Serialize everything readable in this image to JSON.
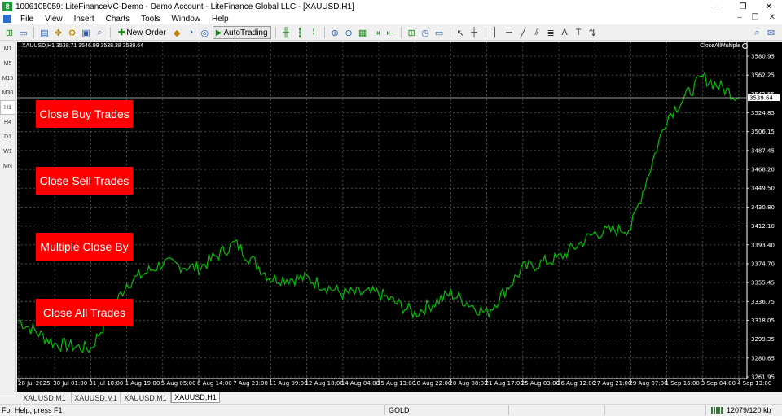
{
  "window": {
    "title": "1006105059: LiteFinanceVC-Demo - Demo Account - LiteFinance Global LLC - [XAUUSD,H1]",
    "app_icon_glyph": "8",
    "controls": [
      "–",
      "❐",
      "✕"
    ]
  },
  "menu": {
    "items": [
      "File",
      "View",
      "Insert",
      "Charts",
      "Tools",
      "Window",
      "Help"
    ],
    "mdi_controls": [
      "–",
      "❐",
      "✕"
    ]
  },
  "toolbar": {
    "new_order_label": "New Order",
    "autotrading_label": "AutoTrading",
    "icons": [
      "new-chart-icon",
      "profiles-icon",
      "market-watch-icon",
      "navigator-icon",
      "data-window-icon",
      "terminal-icon",
      "strategy-tester-icon",
      "new-order-icon",
      "metaeditor-icon",
      "signals-icon",
      "autotrading-icon",
      "bar-chart-icon",
      "candlestick-icon",
      "line-chart-icon",
      "zoom-in-icon",
      "zoom-out-icon",
      "tile-windows-icon",
      "chart-shift-icon",
      "autoscroll-icon",
      "indicators-icon",
      "periods-icon",
      "templates-icon",
      "cursor-icon",
      "crosshair-icon",
      "vertical-line-icon",
      "horizontal-line-icon",
      "trendline-icon",
      "channel-icon",
      "fibonacci-icon",
      "text-icon",
      "text-label-icon",
      "arrows-icon",
      "search-icon",
      "chat-icon"
    ]
  },
  "timeframes": [
    "M1",
    "M5",
    "M15",
    "M30",
    "H1",
    "H4",
    "D1",
    "W1",
    "MN"
  ],
  "active_timeframe": "H1",
  "chart": {
    "header": "XAUUSD,H1  3538.71 3546.99 3538.38 3539.64",
    "ea_name": "CloseAllMultiple",
    "current_price": "3539.64",
    "line_color": "#00c000",
    "grid_color": "#5a5a5a",
    "buttons": [
      {
        "label": "Close Buy Trades"
      },
      {
        "label": "Close Sell Trades"
      },
      {
        "label": "Multiple Close By"
      },
      {
        "label": "Close All Trades"
      }
    ],
    "button_color": "#ff0000",
    "price_labels": [
      "3580.95",
      "3562.25",
      "3543.55",
      "3524.85",
      "3506.15",
      "3487.45",
      "3468.20",
      "3449.50",
      "3430.80",
      "3412.10",
      "3393.40",
      "3374.70",
      "3355.45",
      "3336.75",
      "3318.05",
      "3299.35",
      "3280.65",
      "3261.95"
    ],
    "time_labels": [
      "28 Jul 2025",
      "30 Jul 01:00",
      "31 Jul 10:00",
      "1 Aug 19:00",
      "5 Aug 05:00",
      "6 Aug 14:00",
      "7 Aug 23:00",
      "11 Aug 09:00",
      "12 Aug 18:00",
      "14 Aug 04:00",
      "15 Aug 13:00",
      "18 Aug 22:00",
      "20 Aug 08:00",
      "21 Aug 17:00",
      "25 Aug 03:00",
      "26 Aug 12:00",
      "27 Aug 21:00",
      "29 Aug 07:00",
      "1 Sep 16:00",
      "3 Sep 04:00",
      "4 Sep 13:00"
    ]
  },
  "chart_data": {
    "type": "line",
    "title": "XAUUSD,H1",
    "xlabel": "",
    "ylabel": "",
    "ylim": [
      3261.95,
      3590.0
    ],
    "x": [
      "28 Jul 2025",
      "30 Jul 01:00",
      "31 Jul 10:00",
      "1 Aug 19:00",
      "5 Aug 05:00",
      "6 Aug 14:00",
      "7 Aug 23:00",
      "11 Aug 09:00",
      "12 Aug 18:00",
      "14 Aug 04:00",
      "15 Aug 13:00",
      "18 Aug 22:00",
      "20 Aug 08:00",
      "21 Aug 17:00",
      "25 Aug 03:00",
      "26 Aug 12:00",
      "27 Aug 21:00",
      "29 Aug 07:00",
      "1 Sep 16:00",
      "3 Sep 04:00",
      "4 Sep 13:00"
    ],
    "series": [
      {
        "values": [
          3318,
          3295,
          3290,
          3355,
          3375,
          3370,
          3395,
          3360,
          3360,
          3345,
          3345,
          3325,
          3345,
          3325,
          3370,
          3380,
          3405,
          3410,
          3520,
          3560,
          3540
        ]
      }
    ],
    "grid": true
  },
  "tabs": {
    "items": [
      "XAUUSD,M1",
      "XAUUSD,M1",
      "XAUUSD,M1",
      "XAUUSD,H1"
    ],
    "active": 3
  },
  "status": {
    "help": "For Help, press F1",
    "symbol": "GOLD",
    "traffic": "12079/120 kb"
  }
}
